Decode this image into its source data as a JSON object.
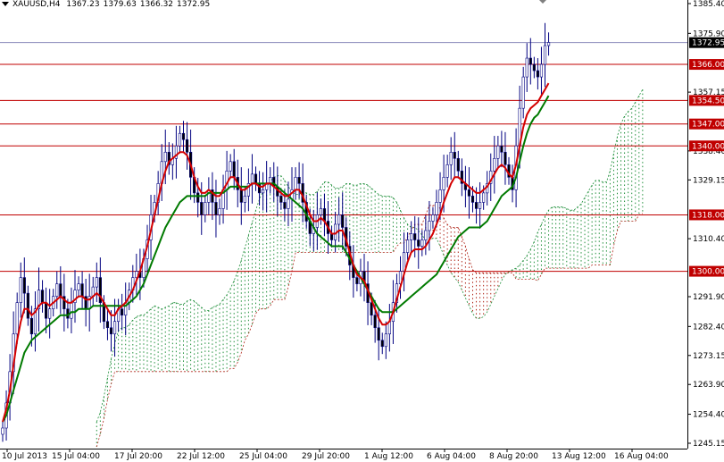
{
  "header": {
    "symbol": "XAUUSD,H4",
    "open": "1367.23",
    "high": "1379.63",
    "low": "1366.32",
    "close": "1372.95"
  },
  "colors": {
    "background": "#ffffff",
    "candle": "#000080",
    "tenkan": "#d40000",
    "kijun": "#007a00",
    "cloud_bull": "#1f8f3a",
    "cloud_bear": "#b0281c",
    "level_line": "#c00000",
    "price_line": "#8c8cbc",
    "axis_text": "#000000"
  },
  "chart_data": {
    "type": "candlestick",
    "indicator": "Ichimoku Kinko Hyo",
    "y_axis": {
      "min": 1245.15,
      "max": 1385.4,
      "ticks": [
        "1385.40",
        "1375.90",
        "1357.15",
        "1338.40",
        "1329.15",
        "1310.40",
        "1291.90",
        "1282.40",
        "1273.15",
        "1263.90",
        "1254.40",
        "1245.15"
      ]
    },
    "x_axis": {
      "ticks": [
        "10 Jul 2013",
        "15 Jul 04:00",
        "17 Jul 20:00",
        "22 Jul 12:00",
        "25 Jul 04:00",
        "29 Jul 20:00",
        "1 Aug 12:00",
        "6 Aug 04:00",
        "8 Aug 20:00",
        "13 Aug 12:00",
        "16 Aug 04:00"
      ]
    },
    "horizontal_levels": [
      {
        "value": 1366.0,
        "label": "1366.00"
      },
      {
        "value": 1354.5,
        "label": "1354.50"
      },
      {
        "value": 1347.0,
        "label": "1347.00"
      },
      {
        "value": 1340.0,
        "label": "1340.00"
      },
      {
        "value": 1318.0,
        "label": "1318.00"
      },
      {
        "value": 1300.0,
        "label": "1300.00"
      }
    ],
    "current_price": {
      "value": 1372.95,
      "label": "1372.95"
    },
    "series_close": [
      1250,
      1258,
      1268,
      1280,
      1290,
      1298,
      1293,
      1285,
      1280,
      1288,
      1294,
      1290,
      1285,
      1288,
      1292,
      1296,
      1292,
      1288,
      1285,
      1290,
      1294,
      1296,
      1292,
      1288,
      1292,
      1295,
      1298,
      1290,
      1284,
      1282,
      1280,
      1284,
      1288,
      1286,
      1290,
      1294,
      1298,
      1300,
      1298,
      1304,
      1310,
      1318,
      1322,
      1328,
      1335,
      1338,
      1334,
      1336,
      1340,
      1344,
      1342,
      1338,
      1330,
      1325,
      1322,
      1318,
      1322,
      1326,
      1322,
      1318,
      1320,
      1326,
      1332,
      1335,
      1330,
      1326,
      1322,
      1324,
      1328,
      1331,
      1328,
      1325,
      1326,
      1328,
      1330,
      1327,
      1324,
      1322,
      1320,
      1323,
      1326,
      1330,
      1328,
      1322,
      1316,
      1312,
      1314,
      1318,
      1320,
      1316,
      1312,
      1310,
      1315,
      1318,
      1314,
      1308,
      1302,
      1298,
      1296,
      1300,
      1296,
      1290,
      1286,
      1282,
      1278,
      1276,
      1280,
      1284,
      1290,
      1296,
      1300,
      1306,
      1310,
      1312,
      1310,
      1308,
      1310,
      1313,
      1316,
      1318,
      1322,
      1326,
      1330,
      1334,
      1338,
      1336,
      1332,
      1328,
      1326,
      1324,
      1322,
      1320,
      1322,
      1325,
      1328,
      1332,
      1336,
      1340,
      1338,
      1334,
      1330,
      1326,
      1340,
      1352,
      1362,
      1368,
      1366,
      1364,
      1362,
      1366,
      1372,
      1373
    ],
    "tenkan": [
      1252,
      1256,
      1262,
      1270,
      1278,
      1284,
      1288,
      1288,
      1286,
      1287,
      1289,
      1290,
      1290,
      1289,
      1290,
      1291,
      1292,
      1291,
      1290,
      1290,
      1291,
      1292,
      1292,
      1291,
      1291,
      1292,
      1293,
      1292,
      1290,
      1288,
      1286,
      1286,
      1288,
      1289,
      1290,
      1292,
      1294,
      1297,
      1300,
      1304,
      1308,
      1313,
      1318,
      1323,
      1328,
      1332,
      1335,
      1336,
      1337,
      1338,
      1338,
      1337,
      1334,
      1330,
      1327,
      1325,
      1325,
      1326,
      1325,
      1324,
      1324,
      1326,
      1328,
      1330,
      1330,
      1328,
      1326,
      1326,
      1327,
      1328,
      1328,
      1327,
      1327,
      1328,
      1328,
      1327,
      1326,
      1325,
      1324,
      1324,
      1325,
      1326,
      1326,
      1324,
      1321,
      1318,
      1316,
      1316,
      1317,
      1316,
      1314,
      1312,
      1312,
      1313,
      1313,
      1310,
      1306,
      1302,
      1299,
      1298,
      1297,
      1294,
      1291,
      1288,
      1285,
      1283,
      1283,
      1284,
      1287,
      1291,
      1295,
      1299,
      1303,
      1306,
      1307,
      1307,
      1307,
      1308,
      1310,
      1312,
      1315,
      1318,
      1322,
      1325,
      1328,
      1330,
      1330,
      1329,
      1328,
      1327,
      1326,
      1325,
      1325,
      1326,
      1327,
      1329,
      1331,
      1333,
      1334,
      1333,
      1331,
      1330,
      1334,
      1340,
      1346,
      1350,
      1352,
      1353,
      1354,
      1356,
      1358,
      1360
    ],
    "kijun": [
      1252,
      1254,
      1258,
      1262,
      1266,
      1270,
      1274,
      1276,
      1278,
      1279,
      1280,
      1281,
      1282,
      1283,
      1284,
      1285,
      1286,
      1286,
      1286,
      1287,
      1287,
      1288,
      1288,
      1288,
      1288,
      1289,
      1289,
      1289,
      1289,
      1289,
      1289,
      1289,
      1289,
      1289,
      1289,
      1290,
      1291,
      1292,
      1294,
      1296,
      1299,
      1302,
      1305,
      1308,
      1311,
      1314,
      1316,
      1318,
      1320,
      1322,
      1323,
      1324,
      1324,
      1324,
      1324,
      1324,
      1324,
      1325,
      1325,
      1325,
      1325,
      1325,
      1326,
      1327,
      1327,
      1327,
      1327,
      1327,
      1327,
      1328,
      1328,
      1328,
      1328,
      1328,
      1328,
      1328,
      1327,
      1326,
      1325,
      1324,
      1323,
      1322,
      1321,
      1320,
      1318,
      1316,
      1314,
      1312,
      1311,
      1310,
      1309,
      1308,
      1308,
      1308,
      1308,
      1306,
      1304,
      1302,
      1300,
      1298,
      1296,
      1294,
      1292,
      1290,
      1288,
      1287,
      1287,
      1287,
      1287,
      1288,
      1289,
      1290,
      1291,
      1292,
      1293,
      1294,
      1295,
      1296,
      1297,
      1298,
      1299,
      1301,
      1303,
      1305,
      1307,
      1309,
      1311,
      1312,
      1313,
      1314,
      1314,
      1314,
      1314,
      1315,
      1316,
      1318,
      1320,
      1322,
      1324,
      1325,
      1326,
      1327,
      1330,
      1335,
      1340,
      1344,
      1347,
      1349,
      1350,
      1352,
      1354,
      1356
    ]
  }
}
